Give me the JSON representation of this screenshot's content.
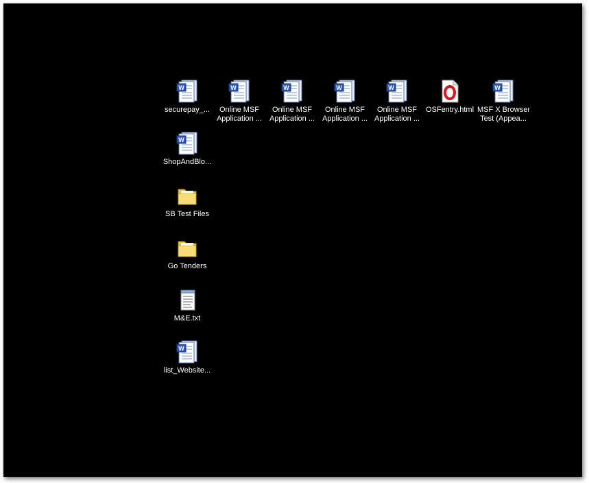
{
  "desktop": {
    "icons": [
      {
        "label_line1": "securepay_...",
        "label_line2": "",
        "icon": "word-document-icon"
      },
      {
        "label_line1": "Online MSF",
        "label_line2": "Application ...",
        "icon": "word-document-icon"
      },
      {
        "label_line1": "Online MSF",
        "label_line2": "Application ...",
        "icon": "word-document-icon"
      },
      {
        "label_line1": "Online MSF",
        "label_line2": "Application ...",
        "icon": "word-document-icon"
      },
      {
        "label_line1": "Online MSF",
        "label_line2": "Application ...",
        "icon": "word-document-icon"
      },
      {
        "label_line1": "OSFentry.html",
        "label_line2": "",
        "icon": "opera-html-icon"
      },
      {
        "label_line1": "MSF X Browser",
        "label_line2": "Test (Appea...",
        "icon": "word-document-icon"
      },
      {
        "label_line1": "ShopAndBlo...",
        "label_line2": "",
        "icon": "word-document-icon"
      },
      {
        "label_line1": "SB Test Files",
        "label_line2": "",
        "icon": "folder-icon"
      },
      {
        "label_line1": "Go Tenders",
        "label_line2": "",
        "icon": "folder-icon"
      },
      {
        "label_line1": "M&E.txt",
        "label_line2": "",
        "icon": "notepad-text-icon"
      },
      {
        "label_line1": "list_Website...",
        "label_line2": "",
        "icon": "word-document-icon"
      }
    ]
  }
}
